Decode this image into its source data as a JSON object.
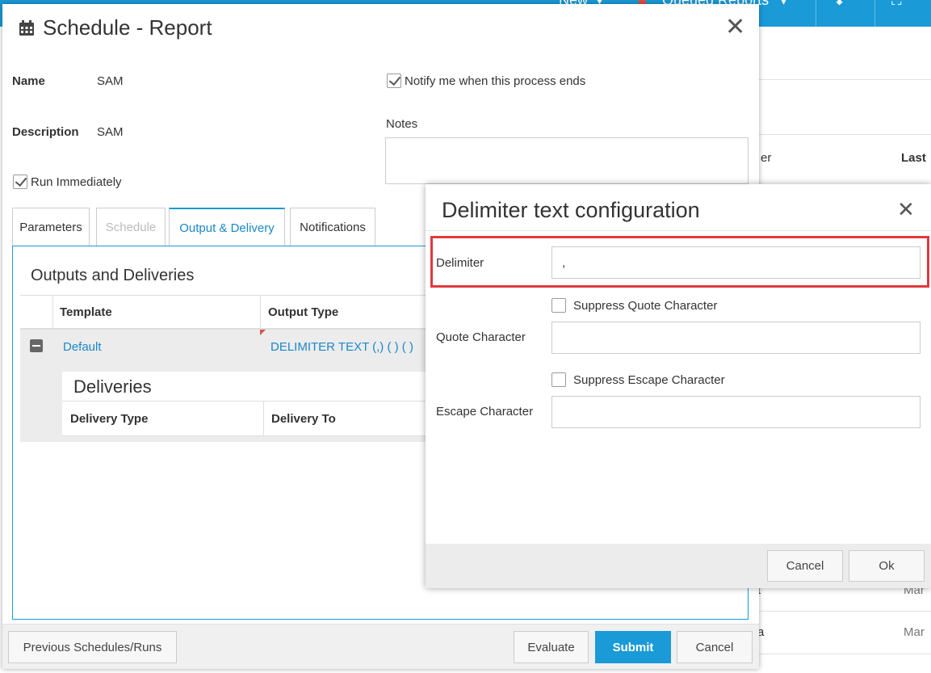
{
  "background": {
    "topbar": {
      "new_label": "New",
      "queued_label": "Queued Reports"
    },
    "col_header_partial": "er",
    "col_header_last": "Last",
    "row_values": [
      "Mar",
      "Mar"
    ],
    "row_partials": [
      "t",
      "a"
    ],
    "colors": {
      "topbar": "#1a9ad7"
    }
  },
  "main_dialog": {
    "title": "Schedule - Report",
    "title_icon": "calendar-icon",
    "name_label": "Name",
    "name_value": "SAM",
    "description_label": "Description",
    "description_value": "SAM",
    "run_immediately_label": "Run Immediately",
    "run_immediately_checked": true,
    "notify_label": "Notify me when this process ends",
    "notify_checked": true,
    "notes_label": "Notes",
    "notes_value": "",
    "tabs": [
      {
        "label": "Parameters",
        "state": "normal"
      },
      {
        "label": "Schedule",
        "state": "disabled"
      },
      {
        "label": "Output & Delivery",
        "state": "active"
      },
      {
        "label": "Notifications",
        "state": "normal"
      }
    ],
    "outputs": {
      "title": "Outputs and Deliveries",
      "headers": [
        "Template",
        "Output Type"
      ],
      "row": {
        "template": "Default",
        "output_type": "DELIMITER TEXT (,) ( ) ( )"
      },
      "deliveries": {
        "title": "Deliveries",
        "headers": [
          "Delivery Type",
          "Delivery To"
        ]
      }
    },
    "footer": {
      "previous_label": "Previous Schedules/Runs",
      "evaluate_label": "Evaluate",
      "submit_label": "Submit",
      "cancel_label": "Cancel"
    }
  },
  "delimiter_dialog": {
    "title": "Delimiter text configuration",
    "delimiter_label": "Delimiter",
    "delimiter_value": ",",
    "suppress_quote_label": "Suppress Quote Character",
    "suppress_quote_checked": false,
    "quote_label": "Quote Character",
    "quote_value": "",
    "suppress_escape_label": "Suppress Escape Character",
    "suppress_escape_checked": false,
    "escape_label": "Escape Character",
    "escape_value": "",
    "cancel_label": "Cancel",
    "ok_label": "Ok",
    "highlight_color": "#e0393e"
  }
}
